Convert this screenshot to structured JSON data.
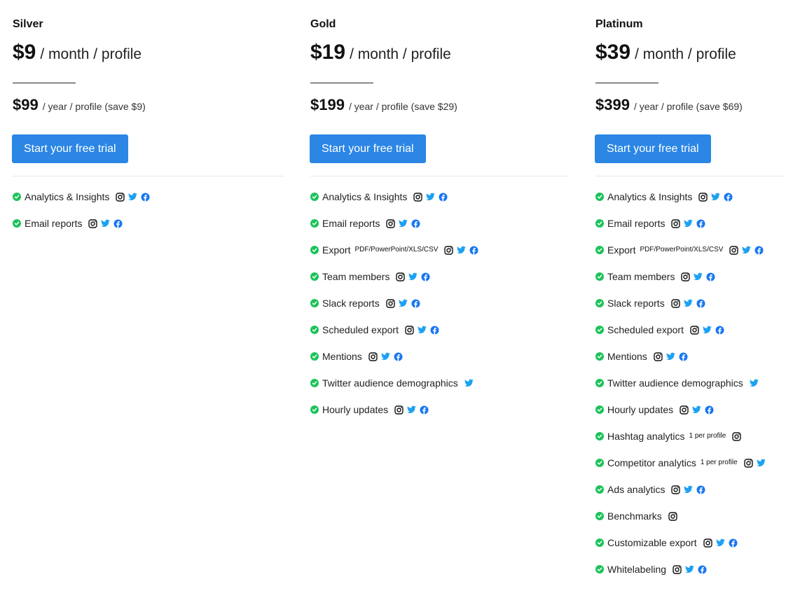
{
  "colors": {
    "button": "#2b86e4",
    "check": "#1cc35a",
    "instagram": "#111111",
    "twitter": "#1da1f2",
    "facebook": "#1877f2"
  },
  "plans": [
    {
      "name": "Silver",
      "price_month": "$9",
      "price_month_suffix": "/ month / profile",
      "price_year": "$99",
      "price_year_suffix": "/ year / profile (save $9)",
      "cta_label": "Start your free trial",
      "features": [
        {
          "label": "Analytics & Insights",
          "sup": "",
          "networks": [
            "instagram-icon",
            "twitter-icon",
            "facebook-icon"
          ]
        },
        {
          "label": "Email reports",
          "sup": "",
          "networks": [
            "instagram-icon",
            "twitter-icon",
            "facebook-icon"
          ]
        }
      ]
    },
    {
      "name": "Gold",
      "price_month": "$19",
      "price_month_suffix": "/ month / profile",
      "price_year": "$199",
      "price_year_suffix": "/ year / profile (save $29)",
      "cta_label": "Start your free trial",
      "features": [
        {
          "label": "Analytics & Insights",
          "sup": "",
          "networks": [
            "instagram-icon",
            "twitter-icon",
            "facebook-icon"
          ]
        },
        {
          "label": "Email reports",
          "sup": "",
          "networks": [
            "instagram-icon",
            "twitter-icon",
            "facebook-icon"
          ]
        },
        {
          "label": "Export",
          "sup": "PDF/PowerPoint/XLS/CSV",
          "networks": [
            "instagram-icon",
            "twitter-icon",
            "facebook-icon"
          ]
        },
        {
          "label": "Team members",
          "sup": "",
          "networks": [
            "instagram-icon",
            "twitter-icon",
            "facebook-icon"
          ]
        },
        {
          "label": "Slack reports",
          "sup": "",
          "networks": [
            "instagram-icon",
            "twitter-icon",
            "facebook-icon"
          ]
        },
        {
          "label": "Scheduled export",
          "sup": "",
          "networks": [
            "instagram-icon",
            "twitter-icon",
            "facebook-icon"
          ]
        },
        {
          "label": "Mentions",
          "sup": "",
          "networks": [
            "instagram-icon",
            "twitter-icon",
            "facebook-icon"
          ]
        },
        {
          "label": "Twitter audience demographics",
          "sup": "",
          "networks": [
            "twitter-icon"
          ]
        },
        {
          "label": "Hourly updates",
          "sup": "",
          "networks": [
            "instagram-icon",
            "twitter-icon",
            "facebook-icon"
          ]
        }
      ]
    },
    {
      "name": "Platinum",
      "price_month": "$39",
      "price_month_suffix": "/ month / profile",
      "price_year": "$399",
      "price_year_suffix": "/ year / profile (save $69)",
      "cta_label": "Start your free trial",
      "features": [
        {
          "label": "Analytics & Insights",
          "sup": "",
          "networks": [
            "instagram-icon",
            "twitter-icon",
            "facebook-icon"
          ]
        },
        {
          "label": "Email reports",
          "sup": "",
          "networks": [
            "instagram-icon",
            "twitter-icon",
            "facebook-icon"
          ]
        },
        {
          "label": "Export",
          "sup": "PDF/PowerPoint/XLS/CSV",
          "networks": [
            "instagram-icon",
            "twitter-icon",
            "facebook-icon"
          ]
        },
        {
          "label": "Team members",
          "sup": "",
          "networks": [
            "instagram-icon",
            "twitter-icon",
            "facebook-icon"
          ]
        },
        {
          "label": "Slack reports",
          "sup": "",
          "networks": [
            "instagram-icon",
            "twitter-icon",
            "facebook-icon"
          ]
        },
        {
          "label": "Scheduled export",
          "sup": "",
          "networks": [
            "instagram-icon",
            "twitter-icon",
            "facebook-icon"
          ]
        },
        {
          "label": "Mentions",
          "sup": "",
          "networks": [
            "instagram-icon",
            "twitter-icon",
            "facebook-icon"
          ]
        },
        {
          "label": "Twitter audience demographics",
          "sup": "",
          "networks": [
            "twitter-icon"
          ]
        },
        {
          "label": "Hourly updates",
          "sup": "",
          "networks": [
            "instagram-icon",
            "twitter-icon",
            "facebook-icon"
          ]
        },
        {
          "label": "Hashtag analytics",
          "sup": "1 per profile",
          "networks": [
            "instagram-icon"
          ]
        },
        {
          "label": "Competitor analytics",
          "sup": "1 per profile",
          "networks": [
            "instagram-icon",
            "twitter-icon"
          ]
        },
        {
          "label": "Ads analytics",
          "sup": "",
          "networks": [
            "instagram-icon",
            "twitter-icon",
            "facebook-icon"
          ]
        },
        {
          "label": "Benchmarks",
          "sup": "",
          "networks": [
            "instagram-icon"
          ]
        },
        {
          "label": "Customizable export",
          "sup": "",
          "networks": [
            "instagram-icon",
            "twitter-icon",
            "facebook-icon"
          ]
        },
        {
          "label": "Whitelabeling",
          "sup": "",
          "networks": [
            "instagram-icon",
            "twitter-icon",
            "facebook-icon"
          ]
        }
      ]
    }
  ]
}
